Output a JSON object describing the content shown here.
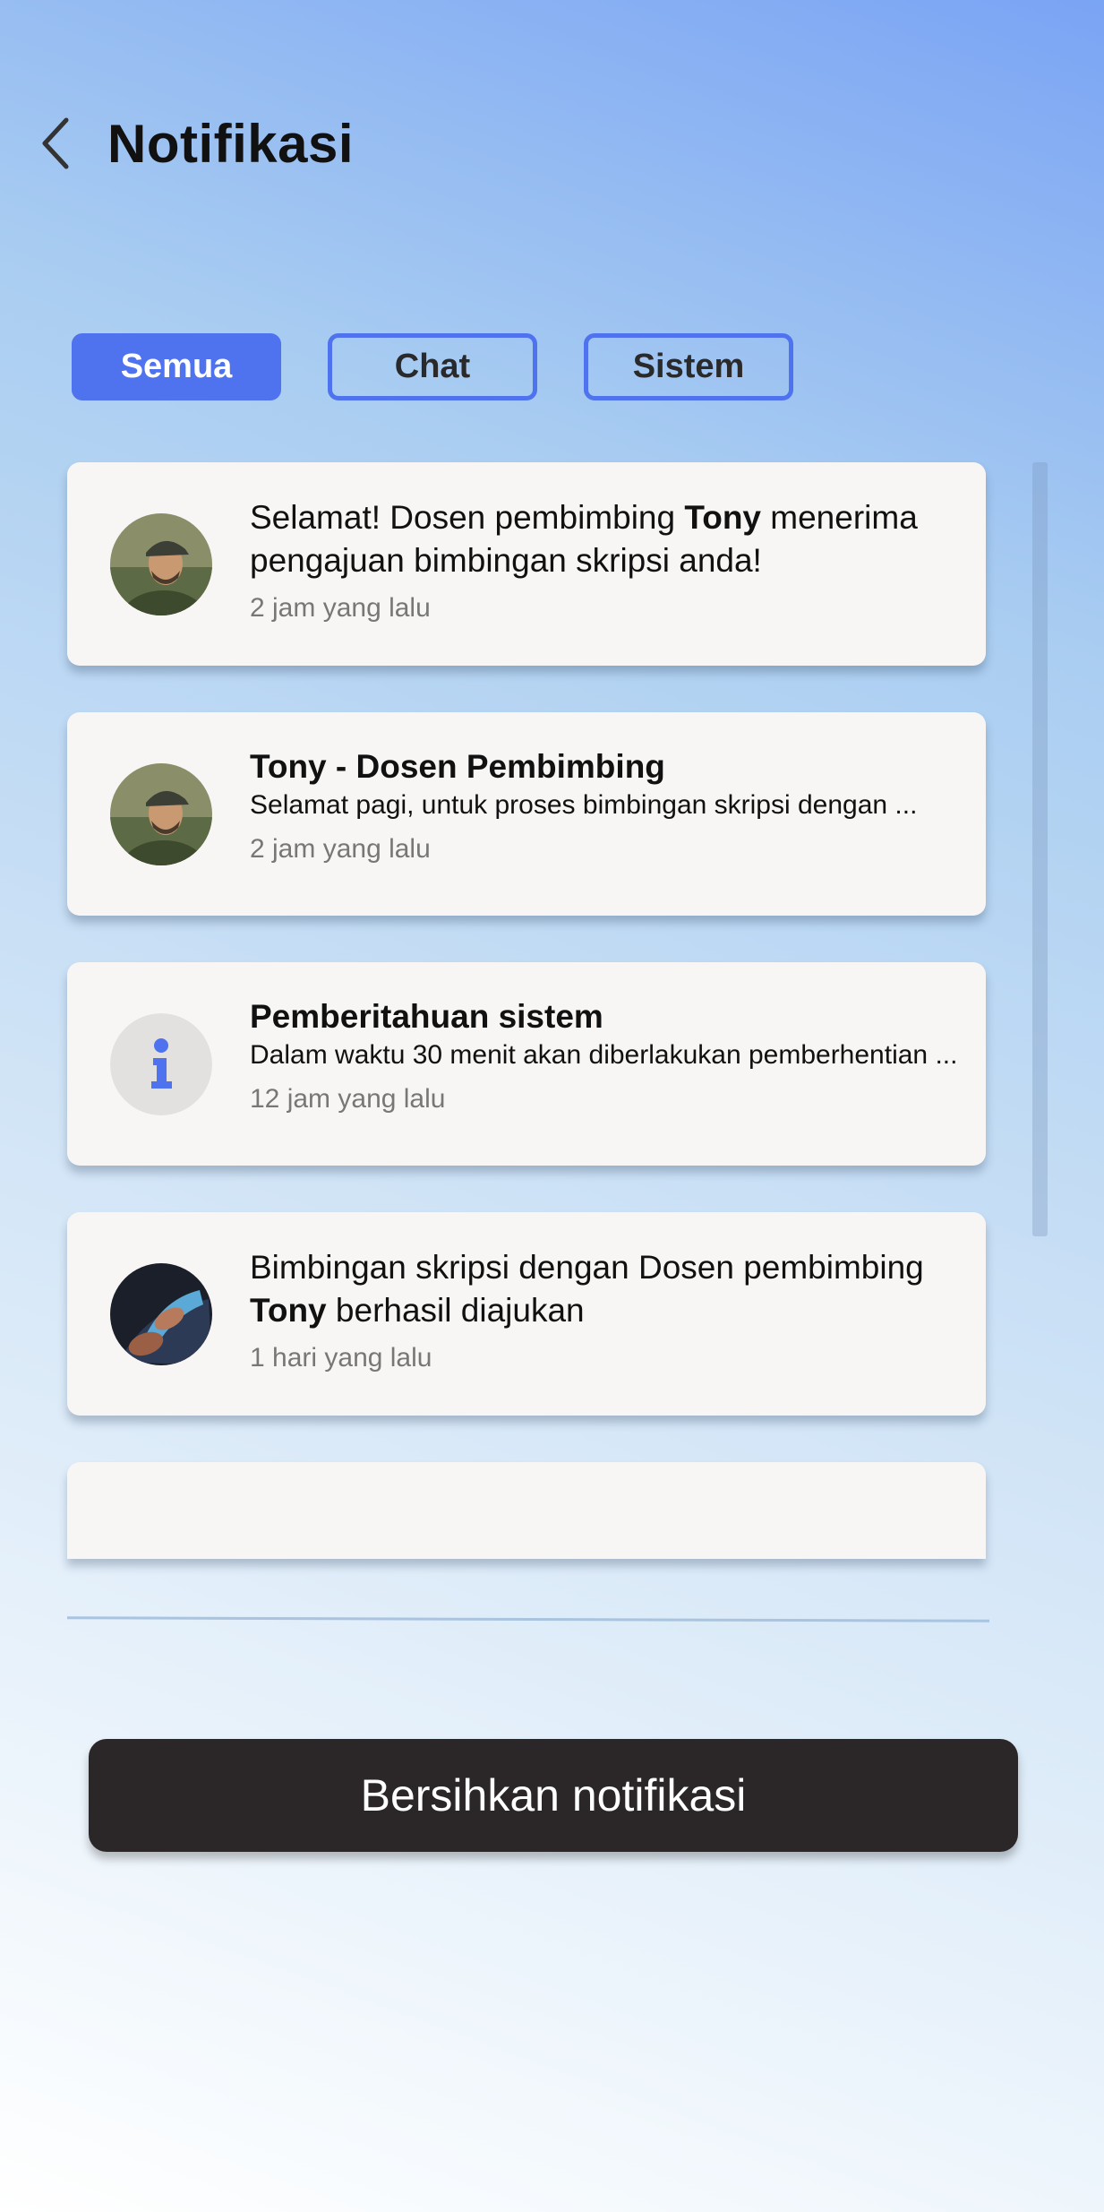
{
  "header": {
    "title": "Notifikasi",
    "back_icon": "chevron-left-icon"
  },
  "tabs": [
    {
      "label": "Semua",
      "active": true
    },
    {
      "label": "Chat",
      "active": false
    },
    {
      "label": "Sistem",
      "active": false
    }
  ],
  "notifications": [
    {
      "avatar": "person-cap-avatar",
      "msg_before": "Selamat! Dosen pembimbing ",
      "msg_bold": "Tony",
      "msg_after": " menerima pengajuan bimbingan skripsi anda!",
      "time": "2 jam yang lalu"
    },
    {
      "avatar": "person-cap-avatar",
      "title": "Tony - Dosen Pembimbing",
      "preview": "Selamat pagi, untuk proses bimbingan skripsi dengan ...",
      "time": "2 jam yang lalu"
    },
    {
      "avatar": "info-icon",
      "title": "Pemberitahuan sistem",
      "preview": "Dalam waktu 30 menit akan diberlakukan pemberhentian ...",
      "time": "12 jam yang lalu"
    },
    {
      "avatar": "hands-avatar",
      "msg_before": "Bimbingan skripsi dengan Dosen pembimbing ",
      "msg_bold": "Tony",
      "msg_after": " berhasil diajukan",
      "time": "1 hari yang lalu"
    }
  ],
  "actions": {
    "clear_label": "Bersihkan notifikasi"
  },
  "colors": {
    "accent": "#4f73ef",
    "card_bg": "#f8f6f4",
    "button_bg": "#2b2728"
  }
}
